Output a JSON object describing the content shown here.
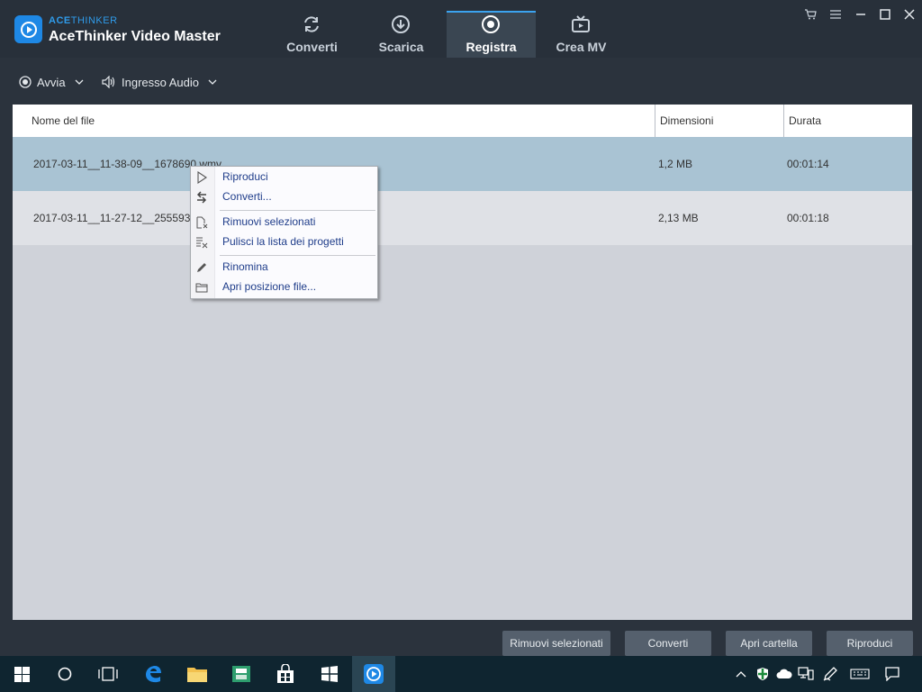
{
  "app": {
    "brand_prefix": "ACE",
    "brand_suffix": "THINKER",
    "title": "AceThinker Video Master"
  },
  "tabs": [
    {
      "label": "Converti",
      "icon": "refresh-icon",
      "active": false
    },
    {
      "label": "Scarica",
      "icon": "download-icon",
      "active": false
    },
    {
      "label": "Registra",
      "icon": "record-icon",
      "active": true
    },
    {
      "label": "Crea MV",
      "icon": "tv-icon",
      "active": false
    }
  ],
  "window_controls": [
    "cart-icon",
    "menu-icon",
    "minimize-icon",
    "maximize-icon",
    "close-icon"
  ],
  "toolbar": {
    "start_label": "Avvia",
    "audio_label": "Ingresso Audio"
  },
  "table": {
    "headers": {
      "name": "Nome del file",
      "size": "Dimensioni",
      "duration": "Durata"
    },
    "rows": [
      {
        "name": "2017-03-11__11-38-09__1678690.wmv",
        "size": "1,2 MB",
        "duration": "00:01:14",
        "selected": true
      },
      {
        "name": "2017-03-11__11-27-12__2555933.wmv",
        "size": "2,13 MB",
        "duration": "00:01:18",
        "selected": false
      }
    ]
  },
  "context_menu": {
    "play": "Riproduci",
    "convert": "Converti...",
    "remove_selected": "Rimuovi selezionati",
    "clear_list": "Pulisci la lista dei progetti",
    "rename": "Rinomina",
    "open_location": "Apri posizione file..."
  },
  "bottom_buttons": {
    "remove": "Rimuovi selezionati",
    "convert": "Converti",
    "open_folder": "Apri cartella",
    "play": "Riproduci"
  },
  "colors": {
    "accent": "#3ba3ef",
    "selected_row": "#a9c3d3",
    "menu_text": "#1f3d8a"
  }
}
